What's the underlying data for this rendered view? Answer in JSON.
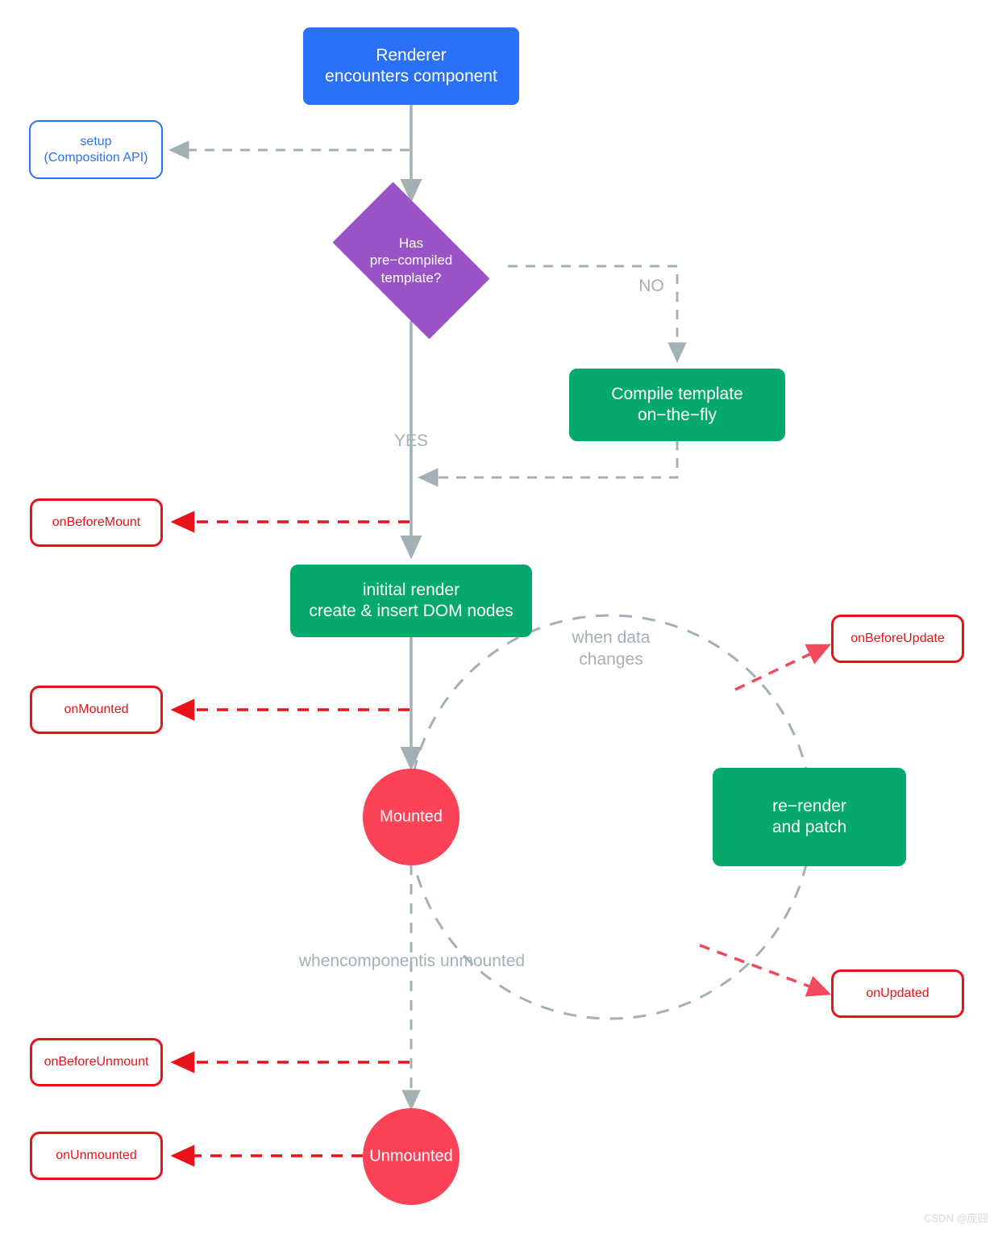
{
  "diagram": {
    "title": "Vue component lifecycle flowchart",
    "colors": {
      "blue_fill": "#2a71f7",
      "green_fill": "#06a96c",
      "purple_fill": "#9a53c6",
      "red_circle": "#fb4257",
      "hook_red": "#e8131a",
      "connector_gray": "#a3b1b5"
    },
    "nodes": [
      {
        "id": "renderer",
        "label": "Renderer\nencounters component",
        "shape": "rounded-rect",
        "style": "blue-filled"
      },
      {
        "id": "setup",
        "label": "setup\n(Composition API)",
        "shape": "rounded-rect",
        "style": "blue-outlined"
      },
      {
        "id": "has_template",
        "label": "Has\npre−compiled\ntemplate?",
        "shape": "diamond",
        "style": "purple-filled"
      },
      {
        "id": "compile",
        "label": "Compile template\non−the−fly",
        "shape": "rounded-rect",
        "style": "green-filled"
      },
      {
        "id": "initial_render",
        "label": "initital render\ncreate & insert DOM nodes",
        "shape": "rounded-rect",
        "style": "green-filled"
      },
      {
        "id": "mounted",
        "label": "Mounted",
        "shape": "circle",
        "style": "red-filled"
      },
      {
        "id": "rerender",
        "label": "re−render\nand patch",
        "shape": "rounded-rect",
        "style": "green-filled"
      },
      {
        "id": "unmounted",
        "label": "Unmounted",
        "shape": "circle",
        "style": "red-filled"
      },
      {
        "id": "on_before_mount",
        "label": "onBeforeMount",
        "shape": "rounded-rect",
        "style": "red-outlined"
      },
      {
        "id": "on_mounted",
        "label": "onMounted",
        "shape": "rounded-rect",
        "style": "red-outlined"
      },
      {
        "id": "on_before_update",
        "label": "onBeforeUpdate",
        "shape": "rounded-rect",
        "style": "red-outlined"
      },
      {
        "id": "on_updated",
        "label": "onUpdated",
        "shape": "rounded-rect",
        "style": "red-outlined"
      },
      {
        "id": "on_before_unmount",
        "label": "onBeforeUnmount",
        "shape": "rounded-rect",
        "style": "red-outlined"
      },
      {
        "id": "on_unmounted",
        "label": "onUnmounted",
        "shape": "rounded-rect",
        "style": "red-outlined"
      }
    ],
    "edge_labels": {
      "no": "NO",
      "yes": "YES",
      "when_data_changes": "when data\nchanges",
      "when_component_unmounted": "whencomponentis unmounted"
    },
    "watermark": "CSDN @庞囧"
  }
}
